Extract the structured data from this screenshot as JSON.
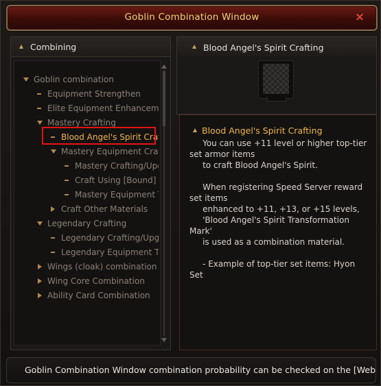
{
  "window": {
    "title": "Goblin Combination Window",
    "close_icon": "×"
  },
  "left_panel": {
    "header": "Combining",
    "tree": [
      {
        "label": "Goblin combination",
        "marker": "arrow-down",
        "level": 0
      },
      {
        "label": "Equipment Strengthen",
        "marker": "dash",
        "level": 1
      },
      {
        "label": "Elite Equipment Enhancemer",
        "marker": "dash",
        "level": 1
      },
      {
        "label": "Mastery Crafting",
        "marker": "arrow-down",
        "level": 1
      },
      {
        "label": "Blood Angel's Spirit Craft",
        "marker": "dash",
        "level": 2,
        "selected": true
      },
      {
        "label": "Mastery Equipment Craft",
        "marker": "arrow-down",
        "level": 2
      },
      {
        "label": "Mastery Crafting/Upg",
        "marker": "dash",
        "level": 3
      },
      {
        "label": "Craft Using [Bound] M",
        "marker": "dash",
        "level": 3
      },
      {
        "label": "Mastery Equipment T",
        "marker": "dash",
        "level": 3
      },
      {
        "label": "Craft Other Materials",
        "marker": "arrow-right",
        "level": 2
      },
      {
        "label": "Legendary Crafting",
        "marker": "arrow-down",
        "level": 1
      },
      {
        "label": "Legendary Crafting/Upgra",
        "marker": "dash",
        "level": 2
      },
      {
        "label": "Legendary Equipment Tra",
        "marker": "dash",
        "level": 2
      },
      {
        "label": "Wings (cloak) combination",
        "marker": "arrow-right",
        "level": 1
      },
      {
        "label": "Wing Core Combination",
        "marker": "arrow-right",
        "level": 1
      },
      {
        "label": "Ability Card Combination",
        "marker": "arrow-right",
        "level": 1
      }
    ]
  },
  "right_panel": {
    "header": "Blood Angel's Spirit Crafting",
    "description_title": "Blood Angel's Spirit Crafting",
    "description_lines": [
      "     You can use +11 level or higher top-tier set armor items",
      "     to craft Blood Angel's Spirit.",
      "",
      "     When registering Speed Server reward set items",
      "     enhanced to +11, +13, or +15 levels,",
      "     'Blood Angel's Spirit Transformation Mark'",
      "     is used as a combination material.",
      "",
      "     - Example of top-tier set items: Hyon Set"
    ]
  },
  "bottom_bar": {
    "message": "Goblin Combination Window combination probability can be checked on the [Website -"
  },
  "colors": {
    "accent_gold": "#f0d27a",
    "highlight_orange": "#f0b54a",
    "selection_red": "#e31414",
    "title_bar_red": "#6b1a12"
  }
}
